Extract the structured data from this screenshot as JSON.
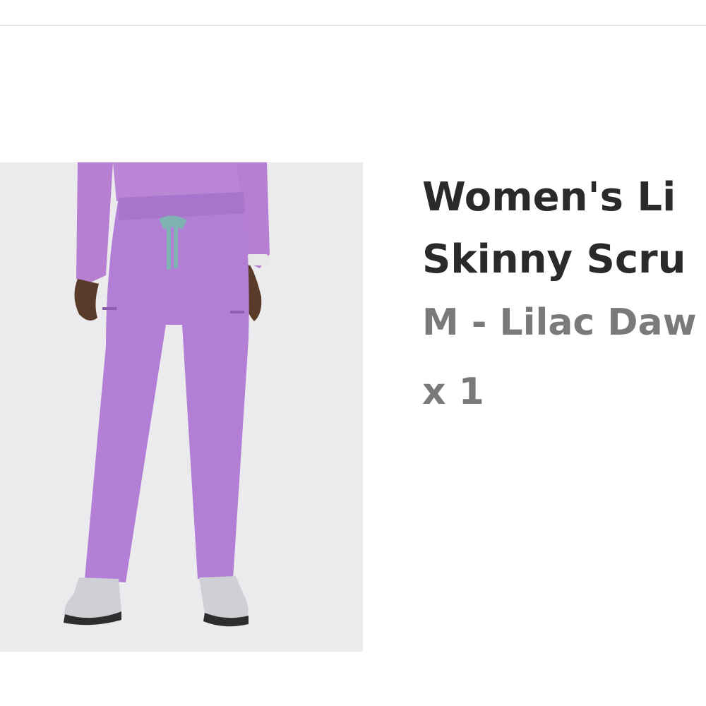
{
  "cart_item": {
    "title_line1": "Women's Li",
    "title_line2": "Skinny Scru",
    "variant": "M - Lilac Daw",
    "quantity": "x 1"
  },
  "colors": {
    "product_color": "#b37fd6",
    "drawstring_color": "#7fb2b3",
    "image_background": "#ebebed",
    "title_text": "#2a2a2a",
    "meta_text": "#7a7a7a"
  }
}
